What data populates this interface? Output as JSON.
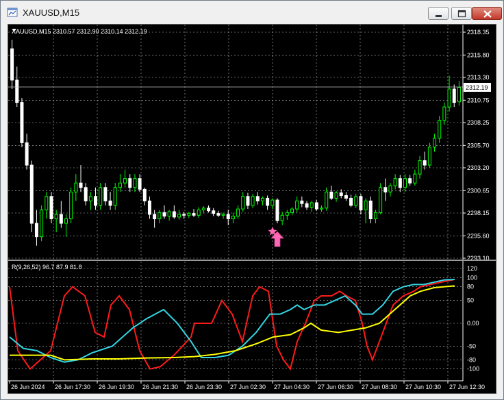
{
  "window": {
    "title": "XAUUSD,M15",
    "buttons": [
      "minimize",
      "maximize",
      "close"
    ]
  },
  "main_chart": {
    "info": "XAUUSD,M15  2310.57 2312.90 2310.14 2312.19",
    "current_price": "2312.19",
    "price_ticks": [
      "2318.35",
      "2315.80",
      "2313.30",
      "2310.75",
      "2308.25",
      "2305.70",
      "2303.20",
      "2300.65",
      "2298.15",
      "2295.60",
      "2293.10"
    ],
    "colors": {
      "bull": "#00ff00",
      "bear": "#ffffff",
      "bg": "#000000",
      "grid": "#c0c0c0",
      "signal_arrow": "#ff69b4"
    }
  },
  "indicator": {
    "label": "R(9,26,52) 96.7 87.9 81.8",
    "ticks": [
      "120",
      "100",
      "80",
      "50",
      "0.00",
      "-50",
      "-80",
      "-100"
    ],
    "series_colors": [
      "#ff1a1a",
      "#33d6e6",
      "#ffff00"
    ]
  },
  "time_axis": [
    "26 Jun 2024",
    "26 Jun 17:30",
    "26 Jun 19:30",
    "26 Jun 21:30",
    "26 Jun 23:30",
    "27 Jun 02:30",
    "27 Jun 04:30",
    "27 Jun 06:30",
    "27 Jun 08:30",
    "27 Jun 10:30",
    "27 Jun 12:30"
  ],
  "chart_data": {
    "type": "candlestick",
    "symbol": "XAUUSD",
    "timeframe": "M15",
    "ylim": [
      2293.1,
      2318.35
    ],
    "candles": [
      [
        2316.5,
        2317.5,
        2312.0,
        2313.0
      ],
      [
        2313.0,
        2314.5,
        2310.0,
        2310.5
      ],
      [
        2310.5,
        2311.0,
        2305.5,
        2306.0
      ],
      [
        2306.0,
        2307.0,
        2303.0,
        2303.5
      ],
      [
        2303.5,
        2304.0,
        2296.0,
        2297.0
      ],
      [
        2297.0,
        2298.5,
        2294.5,
        2295.5
      ],
      [
        2295.5,
        2299.0,
        2295.0,
        2298.5
      ],
      [
        2298.5,
        2300.5,
        2297.5,
        2300.0
      ],
      [
        2300.0,
        2300.5,
        2297.0,
        2297.5
      ],
      [
        2297.5,
        2298.5,
        2296.0,
        2298.0
      ],
      [
        2298.0,
        2299.5,
        2296.5,
        2297.0
      ],
      [
        2297.0,
        2298.0,
        2295.5,
        2297.5
      ],
      [
        2297.5,
        2301.0,
        2297.0,
        2300.5
      ],
      [
        2300.5,
        2302.5,
        2299.5,
        2301.5
      ],
      [
        2301.5,
        2303.5,
        2300.5,
        2301.0
      ],
      [
        2301.0,
        2301.5,
        2299.0,
        2299.5
      ],
      [
        2299.5,
        2300.5,
        2298.5,
        2300.0
      ],
      [
        2300.0,
        2301.0,
        2298.5,
        2299.0
      ],
      [
        2299.0,
        2301.5,
        2298.5,
        2301.0
      ],
      [
        2301.0,
        2301.5,
        2299.0,
        2299.5
      ],
      [
        2299.5,
        2300.5,
        2298.5,
        2299.0
      ],
      [
        2299.0,
        2301.5,
        2298.5,
        2301.0
      ],
      [
        2301.0,
        2302.5,
        2300.5,
        2301.5
      ],
      [
        2301.5,
        2303.0,
        2301.0,
        2302.0
      ],
      [
        2302.0,
        2302.5,
        2300.5,
        2301.0
      ],
      [
        2301.0,
        2302.5,
        2300.5,
        2302.0
      ],
      [
        2302.0,
        2302.5,
        2300.5,
        2300.8
      ],
      [
        2300.8,
        2301.0,
        2299.0,
        2299.5
      ],
      [
        2299.5,
        2300.0,
        2297.5,
        2298.0
      ],
      [
        2298.0,
        2298.5,
        2296.5,
        2297.5
      ],
      [
        2297.5,
        2298.5,
        2297.0,
        2298.2
      ],
      [
        2298.2,
        2299.0,
        2297.5,
        2297.8
      ],
      [
        2297.8,
        2298.5,
        2297.3,
        2298.3
      ],
      [
        2298.3,
        2299.0,
        2297.5,
        2297.7
      ],
      [
        2297.7,
        2298.5,
        2297.4,
        2298.0
      ],
      [
        2298.0,
        2298.3,
        2297.5,
        2297.9
      ],
      [
        2297.9,
        2298.3,
        2297.6,
        2298.1
      ],
      [
        2298.1,
        2298.6,
        2297.7,
        2297.9
      ],
      [
        2297.9,
        2298.8,
        2297.6,
        2298.5
      ],
      [
        2298.5,
        2298.9,
        2298.1,
        2298.7
      ],
      [
        2298.7,
        2299.0,
        2298.2,
        2298.4
      ],
      [
        2298.4,
        2298.7,
        2297.8,
        2298.1
      ],
      [
        2298.1,
        2298.4,
        2297.7,
        2297.9
      ],
      [
        2297.9,
        2298.2,
        2297.5,
        2298.0
      ],
      [
        2298.0,
        2298.5,
        2296.8,
        2297.5
      ],
      [
        2297.5,
        2298.2,
        2297.0,
        2297.8
      ],
      [
        2297.8,
        2299.0,
        2297.5,
        2298.6
      ],
      [
        2298.6,
        2300.5,
        2298.3,
        2300.0
      ],
      [
        2300.0,
        2300.4,
        2298.6,
        2299.0
      ],
      [
        2299.0,
        2300.3,
        2298.7,
        2300.0
      ],
      [
        2300.0,
        2300.5,
        2299.1,
        2299.5
      ],
      [
        2299.5,
        2300.0,
        2299.0,
        2299.8
      ],
      [
        2299.8,
        2300.1,
        2298.5,
        2299.0
      ],
      [
        2299.0,
        2299.8,
        2298.6,
        2299.6
      ],
      [
        2299.6,
        2299.8,
        2297.0,
        2297.3
      ],
      [
        2297.3,
        2298.3,
        2296.8,
        2297.9
      ],
      [
        2297.9,
        2298.5,
        2297.4,
        2298.2
      ],
      [
        2298.2,
        2298.8,
        2297.9,
        2298.6
      ],
      [
        2298.6,
        2300.0,
        2298.2,
        2299.5
      ],
      [
        2299.5,
        2300.0,
        2298.8,
        2299.2
      ],
      [
        2299.2,
        2299.5,
        2298.5,
        2298.8
      ],
      [
        2298.8,
        2299.5,
        2298.3,
        2299.3
      ],
      [
        2299.3,
        2299.6,
        2298.4,
        2298.6
      ],
      [
        2298.6,
        2299.0,
        2298.3,
        2298.7
      ],
      [
        2298.7,
        2301.0,
        2298.4,
        2300.5
      ],
      [
        2300.5,
        2301.2,
        2299.6,
        2299.8
      ],
      [
        2299.8,
        2300.6,
        2299.4,
        2300.4
      ],
      [
        2300.4,
        2300.8,
        2299.8,
        2300.1
      ],
      [
        2300.1,
        2300.5,
        2299.5,
        2299.8
      ],
      [
        2299.8,
        2300.2,
        2298.8,
        2299.0
      ],
      [
        2299.0,
        2300.3,
        2298.7,
        2300.0
      ],
      [
        2300.0,
        2300.3,
        2298.0,
        2298.5
      ],
      [
        2298.5,
        2299.8,
        2297.0,
        2299.5
      ],
      [
        2299.5,
        2300.0,
        2297.0,
        2297.5
      ],
      [
        2297.5,
        2298.5,
        2297.0,
        2298.2
      ],
      [
        2298.2,
        2301.5,
        2298.0,
        2301.0
      ],
      [
        2301.0,
        2302.0,
        2299.5,
        2300.5
      ],
      [
        2300.5,
        2301.5,
        2300.0,
        2301.2
      ],
      [
        2301.2,
        2302.5,
        2300.8,
        2302.0
      ],
      [
        2302.0,
        2302.4,
        2300.5,
        2301.0
      ],
      [
        2301.0,
        2302.5,
        2300.5,
        2302.0
      ],
      [
        2302.0,
        2302.4,
        2301.2,
        2301.5
      ],
      [
        2301.5,
        2303.0,
        2301.2,
        2302.5
      ],
      [
        2302.5,
        2304.5,
        2302.0,
        2304.0
      ],
      [
        2304.0,
        2305.0,
        2303.0,
        2303.5
      ],
      [
        2303.5,
        2306.0,
        2303.2,
        2305.5
      ],
      [
        2305.5,
        2307.0,
        2305.0,
        2306.5
      ],
      [
        2306.5,
        2309.0,
        2306.0,
        2308.5
      ],
      [
        2308.5,
        2310.5,
        2308.0,
        2310.0
      ],
      [
        2310.0,
        2313.5,
        2309.5,
        2312.0
      ],
      [
        2312.0,
        2312.5,
        2310.0,
        2310.5
      ],
      [
        2310.57,
        2312.9,
        2310.14,
        2312.19
      ]
    ]
  }
}
